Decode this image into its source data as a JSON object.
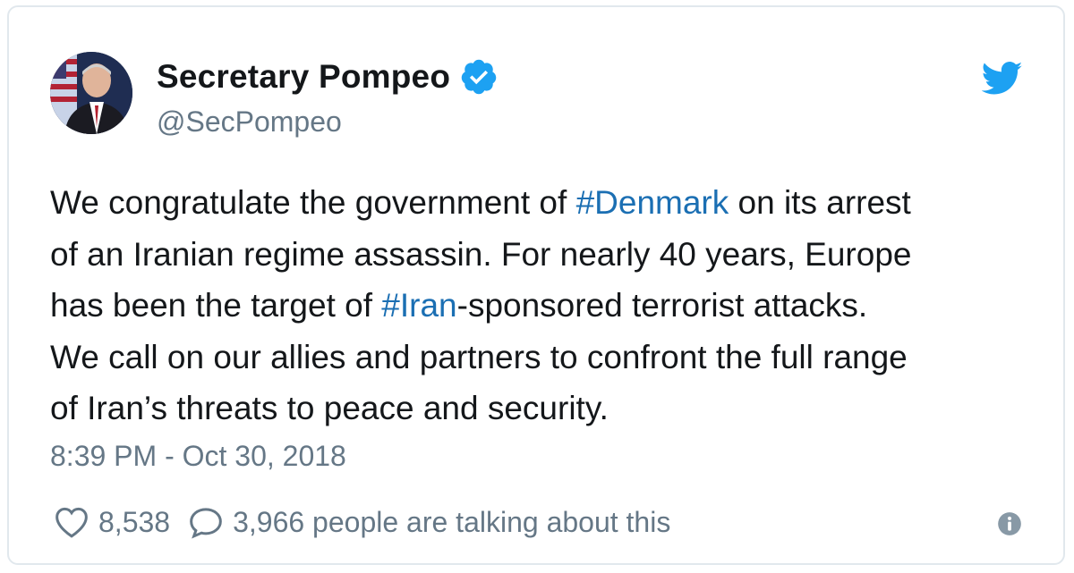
{
  "author": {
    "display_name": "Secretary Pompeo",
    "handle": "@SecPompeo",
    "verified": true,
    "avatar_icon": "person-portrait-icon"
  },
  "tweet": {
    "segments": [
      {
        "text": "We congratulate the government of ",
        "type": "text"
      },
      {
        "text": "#Denmark",
        "type": "hashtag"
      },
      {
        "text": " on its arrest\nof an Iranian regime assassin. For nearly 40 years, Europe\nhas been the target of ",
        "type": "text"
      },
      {
        "text": "#Iran",
        "type": "hashtag"
      },
      {
        "text": "-sponsored terrorist attacks.\nWe call on our allies and partners to confront the full range\nof Iran’s threats to peace and security.",
        "type": "text"
      }
    ],
    "timestamp": "8:39 PM - Oct 30, 2018"
  },
  "actions": {
    "like_count": "8,538",
    "talking_text": "3,966 people are talking about this"
  },
  "icons": {
    "brand": "twitter-bird-icon",
    "verified": "verified-badge-icon",
    "like": "heart-icon",
    "reply": "reply-bubble-icon",
    "info": "info-icon"
  },
  "colors": {
    "brand_blue": "#1da1f2",
    "hashtag_blue": "#1b6fb3",
    "secondary_text": "#657786",
    "primary_text": "#14171a",
    "border": "#e1e8ed"
  }
}
